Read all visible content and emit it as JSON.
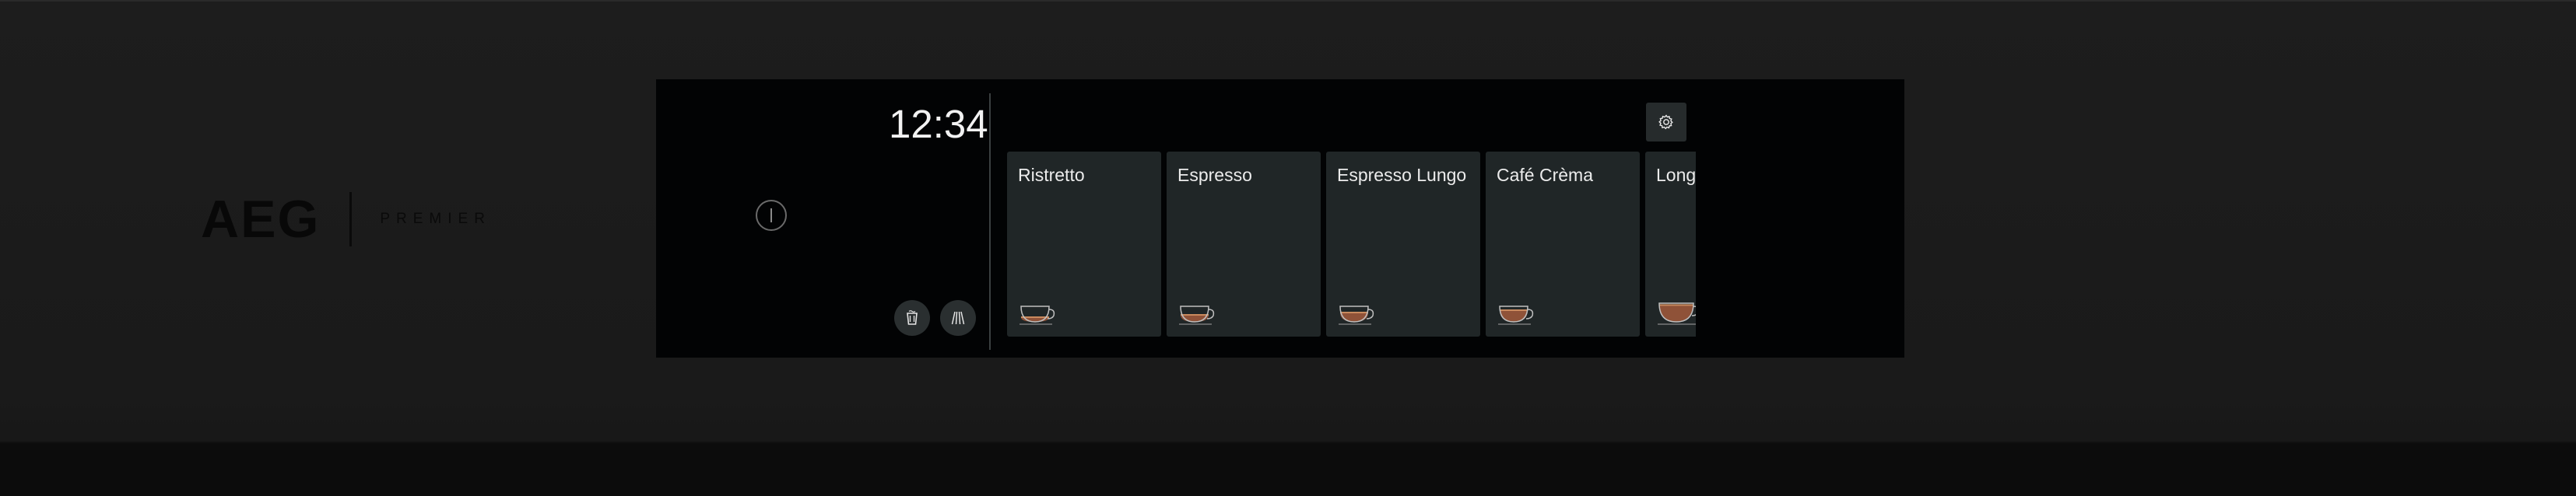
{
  "brand": {
    "logo": "AEG",
    "line": "PREMIER"
  },
  "display": {
    "time": "12:34",
    "beverages": [
      {
        "label": "Ristretto",
        "cup": "small-cup-icon",
        "fill": 0.3
      },
      {
        "label": "Espresso",
        "cup": "small-cup-icon",
        "fill": 0.45
      },
      {
        "label": "Espresso Lungo",
        "cup": "small-cup-icon",
        "fill": 0.6
      },
      {
        "label": "Café Crèma",
        "cup": "small-cup-icon",
        "fill": 0.75
      },
      {
        "label": "Long",
        "cup": "large-cup-icon",
        "fill": 0.9
      }
    ]
  },
  "icons": {
    "power": "power-icon",
    "settings": "gear-icon",
    "cup_holder": "cup-holder-icon",
    "steam": "steam-icon"
  },
  "colors": {
    "screen_bg": "#020304",
    "tile_bg": "#202627",
    "coffee": "#a35a3c",
    "crema": "#c98a5e",
    "text": "#ececec"
  }
}
